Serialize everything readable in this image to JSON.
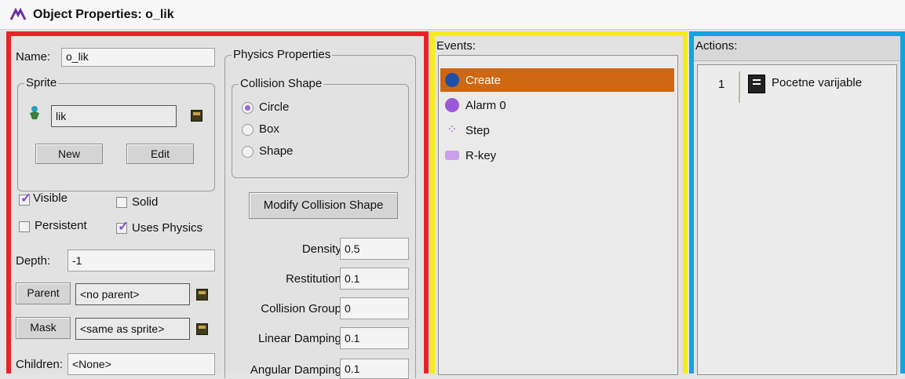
{
  "window": {
    "title": "Object Properties: o_lik"
  },
  "left": {
    "name_label": "Name:",
    "name_value": "o_lik",
    "sprite_group": "Sprite",
    "sprite_value": "lik",
    "new_button": "New",
    "edit_button": "Edit",
    "visible_label": "Visible",
    "solid_label": "Solid",
    "persistent_label": "Persistent",
    "uses_physics_label": "Uses Physics",
    "depth_label": "Depth:",
    "depth_value": "-1",
    "parent_button": "Parent",
    "parent_value": "<no parent>",
    "mask_button": "Mask",
    "mask_value": "<same as sprite>",
    "children_label": "Children:",
    "children_value": "<None>",
    "visible_checked": true,
    "solid_checked": false,
    "persistent_checked": false,
    "uses_physics_checked": true
  },
  "physics": {
    "group_label": "Physics Properties",
    "collision_shape_label": "Collision Shape",
    "shapes": [
      "Circle",
      "Box",
      "Shape"
    ],
    "selected_shape": "Circle",
    "modify_button": "Modify Collision Shape",
    "density_label": "Density:",
    "density_value": "0.5",
    "restitution_label": "Restitution:",
    "restitution_value": "0.1",
    "collision_group_label": "Collision Group:",
    "collision_group_value": "0",
    "linear_damping_label": "Linear Damping:",
    "linear_damping_value": "0.1",
    "angular_damping_label": "Angular Damping:",
    "angular_damping_value": "0.1"
  },
  "events": {
    "label": "Events:",
    "items": [
      {
        "label": "Create",
        "icon": "create-bulb-icon",
        "selected": true
      },
      {
        "label": "Alarm 0",
        "icon": "alarm-clock-icon",
        "selected": false
      },
      {
        "label": "Step",
        "icon": "step-footprints-icon",
        "selected": false
      },
      {
        "label": "R-key",
        "icon": "keyboard-icon",
        "selected": false
      }
    ]
  },
  "actions": {
    "label": "Actions:",
    "items": [
      {
        "index": "1",
        "label": "Pocetne varijable",
        "icon": "code-page-icon"
      }
    ]
  },
  "colors": {
    "red_frame": "#e8242a",
    "yellow_frame": "#f6ee1a",
    "blue_frame": "#16a2e0",
    "selected_event": "#cf6813",
    "check_purple": "#8a52c9"
  }
}
